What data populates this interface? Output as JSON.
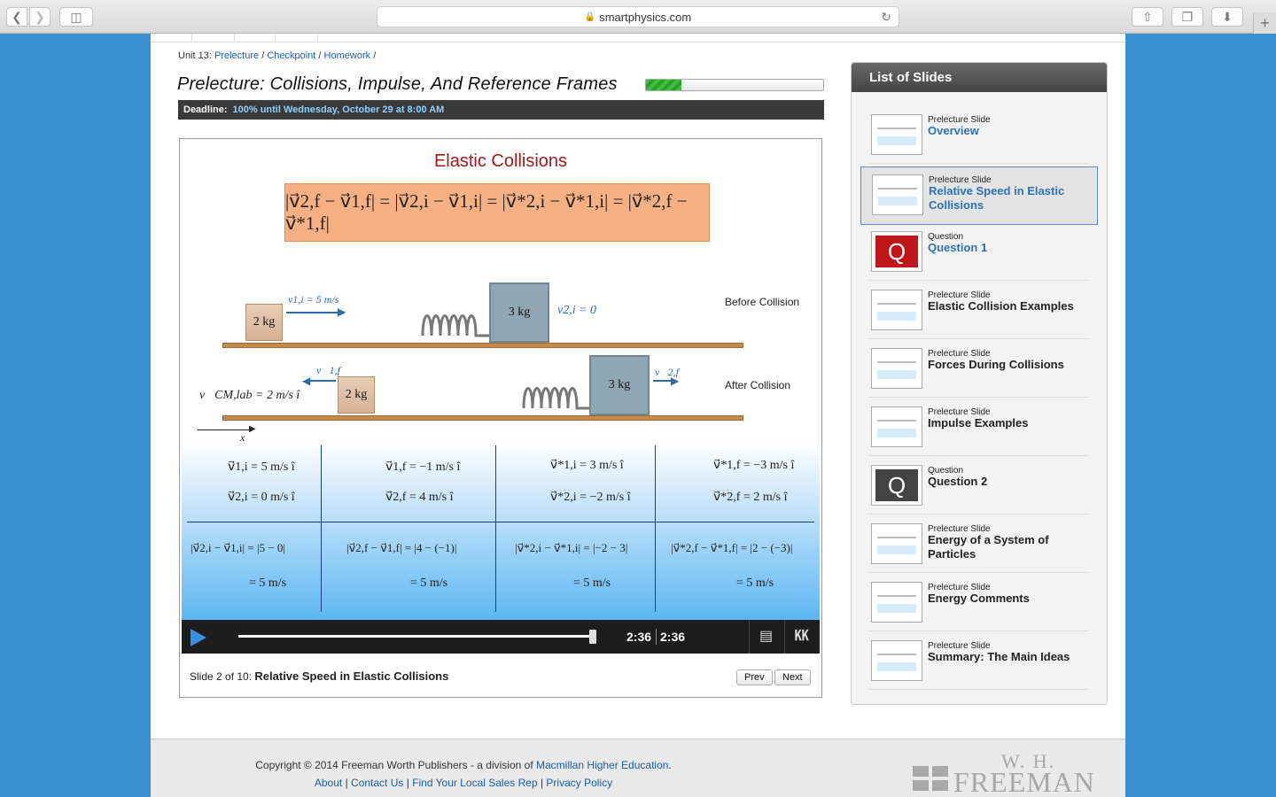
{
  "browser": {
    "url": "smartphysics.com"
  },
  "breadcrumb": {
    "unit": "Unit 13:",
    "items": [
      "Prelecture",
      "Checkpoint",
      "Homework"
    ],
    "sep": "/"
  },
  "page_title": "Prelecture: Collisions, Impulse, And Reference Frames",
  "progress_fraction": 0.2,
  "deadline": {
    "label": "Deadline:",
    "value": "100% until Wednesday, October 29 at 8:00 AM"
  },
  "slide": {
    "title": "Elastic Collisions",
    "formula": "|v⃗2,f − v⃗1,f| = |v⃗2,i − v⃗1,i| = |v⃗*2,i − v⃗*1,i| = |v⃗*2,f − v⃗*1,f|",
    "before_label": "Before Collision",
    "after_label": "After Collision",
    "block_small": "2 kg",
    "block_big": "3 kg",
    "v1i_label": "v1,i = 5 m/s",
    "v2i_label": "v2,i = 0",
    "v1f_label": "v⃗1,f",
    "v2f_label": "v⃗2,f",
    "vcm_label": "v⃗CM,lab = 2 m/s î",
    "x_label": "x",
    "table_top": [
      [
        "v⃗1,i = 5 m/s î",
        "v⃗2,i = 0 m/s î"
      ],
      [
        "v⃗1,f = −1 m/s î",
        "v⃗2,f = 4 m/s î"
      ],
      [
        "v⃗*1,i = 3 m/s î",
        "v⃗*2,i = −2 m/s î"
      ],
      [
        "v⃗*1,f = −3 m/s î",
        "v⃗*2,f = 2 m/s î"
      ]
    ],
    "table_bottom": [
      [
        "|v⃗2,i − v⃗1,i| = |5 − 0|",
        "= 5 m/s"
      ],
      [
        "|v⃗2,f − v⃗1,f| = |4 − (−1)|",
        "= 5 m/s"
      ],
      [
        "|v⃗*2,i − v⃗*1,i| = |−2 − 3|",
        "= 5 m/s"
      ],
      [
        "|v⃗*2,f − v⃗*1,f| = |2 − (−3)|",
        "= 5 m/s"
      ]
    ]
  },
  "player": {
    "current_time": "2:36",
    "duration": "2:36",
    "progress_fraction": 1.0
  },
  "caption": {
    "prefix": "Slide 2 of 10:",
    "title": "Relative Speed in Elastic Collisions"
  },
  "buttons": {
    "prev": "Prev",
    "next": "Next"
  },
  "sidebar": {
    "title": "List of Slides",
    "items": [
      {
        "kind": "Prelecture Slide",
        "name": "Overview",
        "thumb": "slide"
      },
      {
        "kind": "Prelecture Slide",
        "name": "Relative Speed in Elastic Collisions",
        "thumb": "slide"
      },
      {
        "kind": "Question",
        "name": "Question 1",
        "thumb": "question-red"
      },
      {
        "kind": "Prelecture Slide",
        "name": "Elastic Collision Examples",
        "thumb": "slide"
      },
      {
        "kind": "Prelecture Slide",
        "name": "Forces During Collisions",
        "thumb": "slide"
      },
      {
        "kind": "Prelecture Slide",
        "name": "Impulse Examples",
        "thumb": "slide"
      },
      {
        "kind": "Question",
        "name": "Question 2",
        "thumb": "question-grey"
      },
      {
        "kind": "Prelecture Slide",
        "name": "Energy of a System of Particles",
        "thumb": "slide"
      },
      {
        "kind": "Prelecture Slide",
        "name": "Energy Comments",
        "thumb": "slide"
      },
      {
        "kind": "Prelecture Slide",
        "name": "Summary: The Main Ideas",
        "thumb": "slide"
      }
    ],
    "question_glyph": "Q"
  },
  "footer": {
    "copyright": "Copyright © 2014 Freeman Worth Publishers - a division of",
    "copyright_link": "Macmillan Higher Education",
    "copyright_end": ".",
    "links": [
      "About",
      "Contact Us",
      "Find Your Local Sales Rep",
      "Privacy Policy"
    ],
    "logo_top": "W. H.",
    "logo_bottom": "FREEMAN"
  },
  "colors": {
    "slide_title": "#a01818",
    "formula_bg": "#f7b083",
    "accent_link": "#2a73b8",
    "question_red": "#c0161a"
  }
}
